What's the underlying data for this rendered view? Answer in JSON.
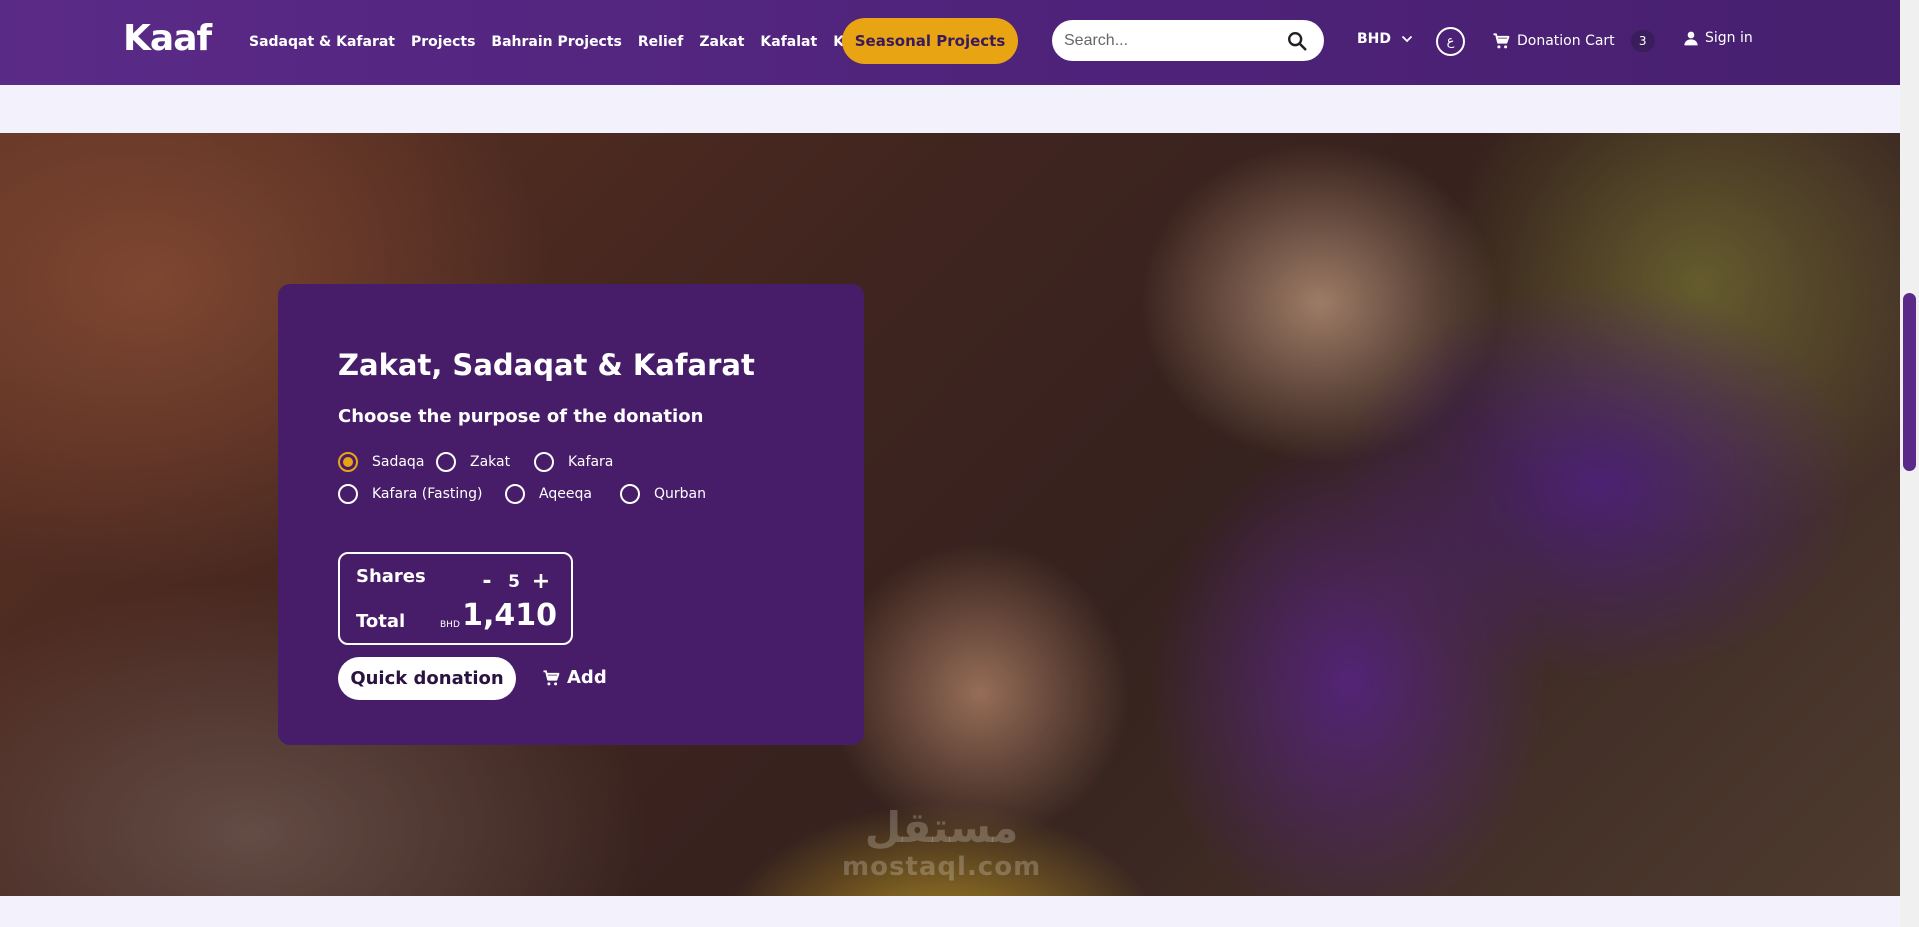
{
  "header": {
    "logo": "Kaaf",
    "nav": [
      {
        "label": "Sadaqat & Kafarat"
      },
      {
        "label": "Projects"
      },
      {
        "label": "Bahrain Projects"
      },
      {
        "label": "Relief"
      },
      {
        "label": "Zakat"
      },
      {
        "label": "Kafalat"
      },
      {
        "label": "Kaff?"
      }
    ],
    "seasonal_label": "Seasonal Projects",
    "search": {
      "placeholder": "Search...",
      "value": ""
    },
    "currency": "BHD",
    "language": "ع",
    "cart": {
      "label": "Donation Cart",
      "count": "3"
    },
    "signin_label": "Sign in"
  },
  "donation": {
    "title": "Zakat, Sadaqat & Kafarat",
    "subtitle": "Choose the purpose of the donation",
    "options": [
      {
        "label": "Sadaqa",
        "checked": true
      },
      {
        "label": "Zakat",
        "checked": false
      },
      {
        "label": "Kafara",
        "checked": false
      },
      {
        "label": "Kafara (Fasting)",
        "checked": false
      },
      {
        "label": "Aqeeqa",
        "checked": false
      },
      {
        "label": "Qurban",
        "checked": false
      }
    ],
    "shares_label": "Shares",
    "decrement": "-",
    "increment": "+",
    "shares": "5",
    "total_label": "Total",
    "total_currency": "BHD",
    "total": "1,410",
    "quick_label": "Quick donation",
    "add_label": "Add"
  },
  "watermark": {
    "arabic": "مستقل",
    "latin": "mostaql.com"
  },
  "colors": {
    "primary": "#4e2279",
    "accent": "#e9a413",
    "card": "#471d69"
  },
  "icons": [
    "search-icon",
    "chevron-down-icon",
    "cart-icon",
    "user-icon"
  ]
}
